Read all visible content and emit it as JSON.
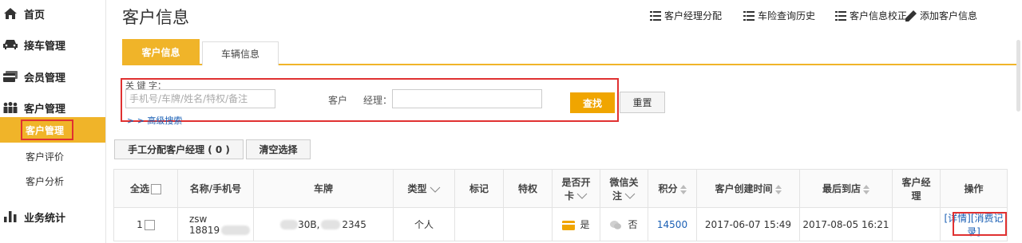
{
  "sidebar": {
    "top_items": [
      {
        "label": "首页",
        "icon": "home-icon"
      },
      {
        "label": "接车管理",
        "icon": "car-icon"
      },
      {
        "label": "会员管理",
        "icon": "card-icon"
      },
      {
        "label": "客户管理",
        "icon": "people-icon"
      },
      {
        "label": "业务统计",
        "icon": "bar-chart-icon"
      }
    ],
    "sub_items": [
      {
        "label": "客户管理",
        "active": true
      },
      {
        "label": "客户评价",
        "active": false
      },
      {
        "label": "客户分析",
        "active": false
      }
    ]
  },
  "header": {
    "title": "客户信息",
    "actions": [
      {
        "label": "客户经理分配",
        "icon": "list-icon"
      },
      {
        "label": "车险查询历史",
        "icon": "list-icon"
      },
      {
        "label": "客户信息校正",
        "icon": "list-icon"
      },
      {
        "label": "添加客户信息",
        "icon": "pencil-icon"
      }
    ]
  },
  "tabs": [
    {
      "label": "客户信息",
      "active": true
    },
    {
      "label": "车辆信息",
      "active": false
    }
  ],
  "search": {
    "keyword_label": "关 键 字：",
    "keyword_placeholder": "手机号/车牌/姓名/特权/备注",
    "manager_label_a": "客户",
    "manager_label_b": "经理：",
    "manager_value": "",
    "search_button": "查找",
    "reset_button": "重置",
    "advanced_link": "> > 高级搜索"
  },
  "toolbar": {
    "assign_button": "手工分配客户经理 ( 0 )",
    "clear_button": "清空选择"
  },
  "table": {
    "headers": {
      "select_all": "全选",
      "name": "名称/手机号",
      "plate": "车牌",
      "type": "类型",
      "tag": "标记",
      "privilege": "特权",
      "card_line1": "是否开",
      "card_line2": "卡",
      "wechat_line1": "微信关",
      "wechat_line2": "注",
      "points": "积分",
      "created": "客户创建时间",
      "last_visit": "最后到店",
      "manager_line1": "客户经",
      "manager_line2": "理",
      "ops": "操作"
    },
    "rows": [
      {
        "index": "1",
        "name": "zsw",
        "phone": "18819",
        "plate_a": "30B,",
        "plate_b": "2345",
        "type": "个人",
        "tag": "",
        "privilege": "",
        "card": "是",
        "wechat": "否",
        "points": "14500",
        "created": "2017-06-07 15:49",
        "last_visit": "2017-08-05 16:21",
        "manager": "",
        "op_detail": "[详情]",
        "op_consume": "[消费记录]"
      }
    ]
  },
  "colors": {
    "accent": "#f0b429",
    "highlight_box": "#e03131",
    "link": "#1a5fb4"
  }
}
